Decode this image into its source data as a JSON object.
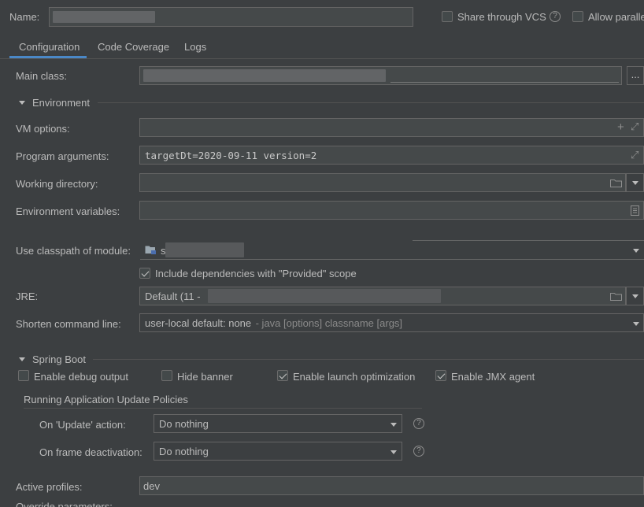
{
  "header": {
    "name_label": "Name:",
    "share_vcs_label": "Share through VCS",
    "share_vcs_checked": false,
    "allow_parallel_label": "Allow paralle",
    "allow_parallel_checked": false
  },
  "tabs": [
    {
      "label": "Configuration",
      "active": true
    },
    {
      "label": "Code Coverage",
      "active": false
    },
    {
      "label": "Logs",
      "active": false
    }
  ],
  "main_class": {
    "label": "Main class:",
    "browse_label": "..."
  },
  "environment": {
    "section_label": "Environment",
    "vm_options_label": "VM options:",
    "program_args_label": "Program arguments:",
    "program_args_value": "targetDt=2020-09-11 version=2",
    "working_dir_label": "Working directory:",
    "env_vars_label": "Environment variables:"
  },
  "classpath": {
    "label": "Use classpath of module:",
    "value": "s",
    "include_provided_label": "Include dependencies with \"Provided\" scope",
    "include_provided_checked": true
  },
  "jre": {
    "label": "JRE:",
    "value": "Default (11 - "
  },
  "shorten": {
    "label": "Shorten command line:",
    "value_main": "user-local default: none",
    "value_hint": " - java [options] classname [args]"
  },
  "spring_boot": {
    "section_label": "Spring Boot",
    "options": [
      {
        "label": "Enable debug output",
        "checked": false
      },
      {
        "label": "Hide banner",
        "checked": false
      },
      {
        "label": "Enable launch optimization",
        "checked": true
      },
      {
        "label": "Enable JMX agent",
        "checked": true
      }
    ],
    "policies_label": "Running Application Update Policies",
    "on_update_label": "On 'Update' action:",
    "on_update_value": "Do nothing",
    "on_frame_label": "On frame deactivation:",
    "on_frame_value": "Do nothing"
  },
  "profiles": {
    "label": "Active profiles:",
    "value": "dev"
  },
  "override": {
    "label": "Override parameters:"
  },
  "colors": {
    "background": "#3c3f41",
    "tab_underline": "#4a88c7",
    "field": "#45494a"
  }
}
